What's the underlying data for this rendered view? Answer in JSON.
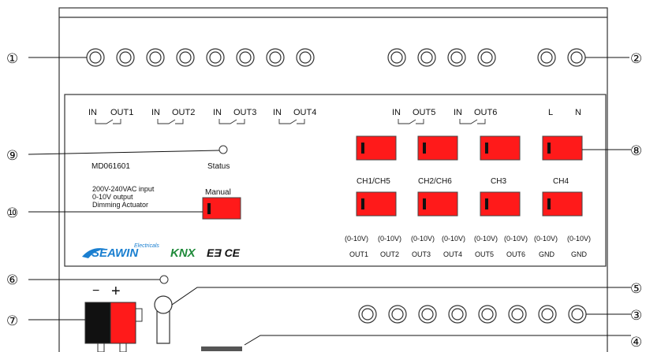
{
  "device": {
    "model": "MD061601",
    "status_label": "Status",
    "description_lines": [
      "200V-240VAC input",
      "0-10V output",
      "Dimming Actuator"
    ],
    "manual_label": "Manual"
  },
  "relays_left": [
    {
      "in": "IN",
      "out": "OUT1"
    },
    {
      "in": "IN",
      "out": "OUT2"
    },
    {
      "in": "IN",
      "out": "OUT3"
    },
    {
      "in": "IN",
      "out": "OUT4"
    }
  ],
  "relays_right": [
    {
      "in": "IN",
      "out": "OUT5"
    },
    {
      "in": "IN",
      "out": "OUT6"
    }
  ],
  "power": {
    "l": "L",
    "n": "N"
  },
  "channels": [
    "CH1/CH5",
    "CH2/CH6",
    "CH3",
    "CH4"
  ],
  "outputs": [
    {
      "range": "(0-10V)",
      "name": "OUT1"
    },
    {
      "range": "(0-10V)",
      "name": "OUT2"
    },
    {
      "range": "(0-10V)",
      "name": "OUT3"
    },
    {
      "range": "(0-10V)",
      "name": "OUT4"
    },
    {
      "range": "(0-10V)",
      "name": "OUT5"
    },
    {
      "range": "(0-10V)",
      "name": "OUT6"
    },
    {
      "range": "(0-10V)",
      "name": "GND"
    },
    {
      "range": "(0-10V)",
      "name": "GND"
    }
  ],
  "logos": {
    "seawin": "SEAWIN",
    "seawin_sub": "Electricals",
    "knx": "KNX",
    "cert": "EƎ CE"
  },
  "polarity": {
    "minus": "−",
    "plus": "+"
  },
  "callouts": [
    "①",
    "②",
    "③",
    "④",
    "⑤",
    "⑥",
    "⑦",
    "⑧",
    "⑨",
    "⑩"
  ],
  "colors": {
    "button_red": "#ff1a1a",
    "outline": "#333333",
    "connector_black": "#111111"
  }
}
